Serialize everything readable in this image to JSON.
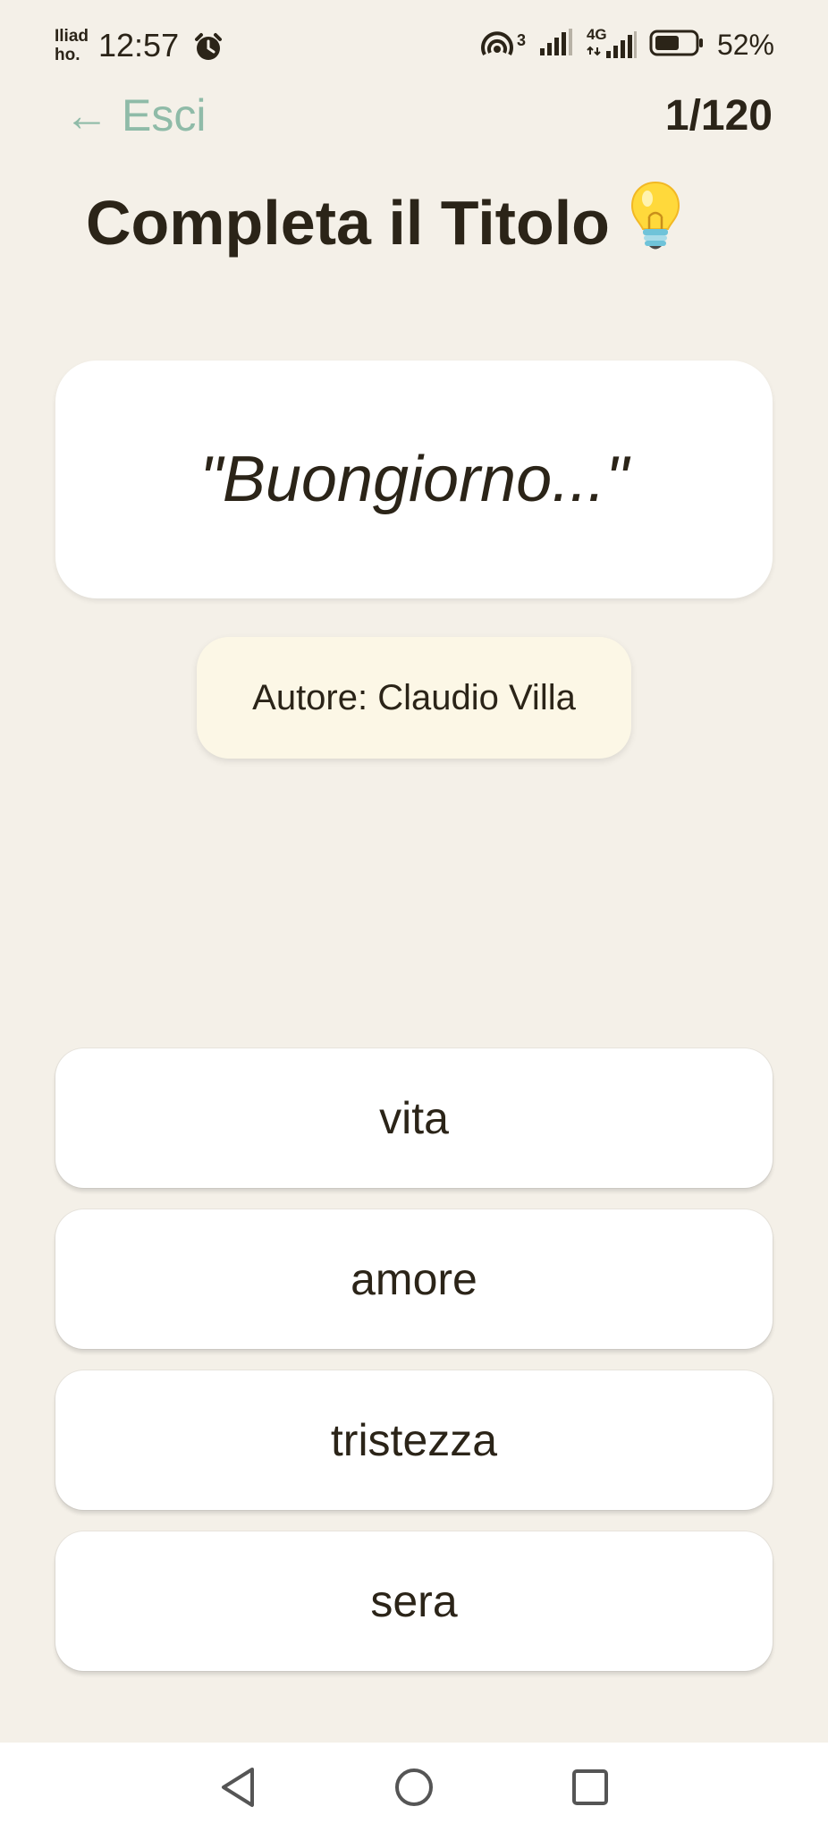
{
  "status_bar": {
    "carrier": "Iliad ho.",
    "time": "12:57",
    "battery": "52%",
    "hotspot_count": "3",
    "network": "4G",
    "icons": [
      "alarm-icon",
      "hotspot-icon",
      "signal-icon",
      "4g-signal-icon",
      "battery-icon"
    ]
  },
  "header": {
    "exit_arrow": "←",
    "exit_label": "Esci",
    "counter": "1/120",
    "title": "Completa il Titolo",
    "title_emoji": "lightbulb-icon"
  },
  "question": {
    "text": "\"Buongiorno...\"",
    "author": "Autore: Claudio Villa"
  },
  "answers": [
    {
      "label": "vita"
    },
    {
      "label": "amore"
    },
    {
      "label": "tristezza"
    },
    {
      "label": "sera"
    }
  ],
  "colors": {
    "background": "#f4f0e8",
    "accent": "#8fbba8",
    "text": "#2b2418",
    "author_badge": "#fcf7e6"
  },
  "nav": {
    "buttons": [
      "back-icon",
      "home-icon",
      "recents-icon"
    ]
  }
}
